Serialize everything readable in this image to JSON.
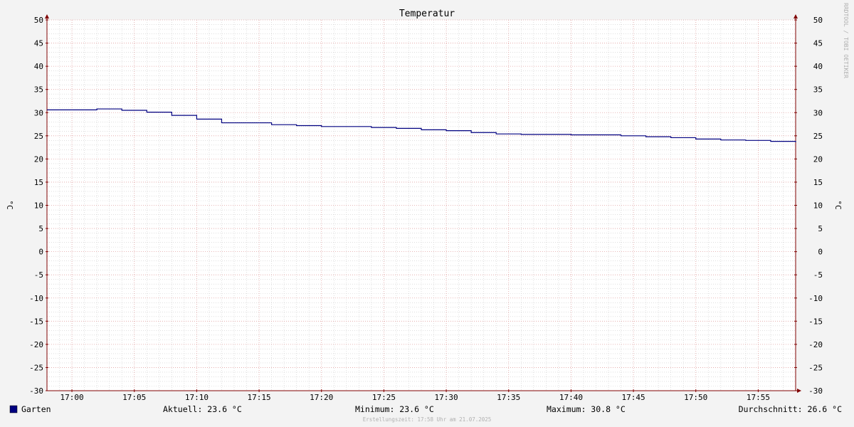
{
  "chart_data": {
    "type": "line",
    "title": "Temperatur",
    "ylabel": "°C",
    "ylim": [
      -30,
      50
    ],
    "yticks": [
      50,
      45,
      40,
      35,
      30,
      25,
      20,
      15,
      10,
      5,
      0,
      -5,
      -10,
      -15,
      -20,
      -25,
      -30
    ],
    "xlim": [
      "16:58",
      "17:58"
    ],
    "xticks": [
      "17:00",
      "17:05",
      "17:10",
      "17:15",
      "17:20",
      "17:25",
      "17:30",
      "17:35",
      "17:40",
      "17:45",
      "17:50",
      "17:55"
    ],
    "grid": true,
    "series": [
      {
        "name": "Garten",
        "color": "#000080",
        "step": true,
        "x": [
          "16:58",
          "17:00",
          "17:02",
          "17:04",
          "17:06",
          "17:08",
          "17:10",
          "17:12",
          "17:14",
          "17:16",
          "17:18",
          "17:20",
          "17:22",
          "17:24",
          "17:26",
          "17:28",
          "17:30",
          "17:32",
          "17:34",
          "17:36",
          "17:38",
          "17:40",
          "17:42",
          "17:44",
          "17:46",
          "17:48",
          "17:50",
          "17:52",
          "17:54",
          "17:56",
          "17:58"
        ],
        "values": [
          30.6,
          30.6,
          30.8,
          30.5,
          30.1,
          29.4,
          28.6,
          27.8,
          27.8,
          27.4,
          27.2,
          27.0,
          27.0,
          26.8,
          26.6,
          26.3,
          26.1,
          25.7,
          25.4,
          25.3,
          25.3,
          25.2,
          25.2,
          25.0,
          24.8,
          24.6,
          24.3,
          24.1,
          24.0,
          23.8,
          23.6
        ]
      }
    ]
  },
  "legend": {
    "series_name": "Garten",
    "swatch_color": "#000080"
  },
  "stats": {
    "current": "Aktuell: 23.6 °C",
    "minimum": "Minimum: 23.6 °C",
    "maximum": "Maximum: 30.8 °C",
    "average": "Durchschnitt: 26.6 °C"
  },
  "footer": "Erstellungszeit: 17:58 Uhr am 21.07.2025",
  "watermark": "RRDTOOL / TOBI OETIKER",
  "colors": {
    "background": "#f3f3f3",
    "canvas": "#ffffff",
    "major_grid": "#e0a0a0",
    "minor_grid": "#cccccc",
    "axis": "#800000",
    "line": "#000080"
  }
}
